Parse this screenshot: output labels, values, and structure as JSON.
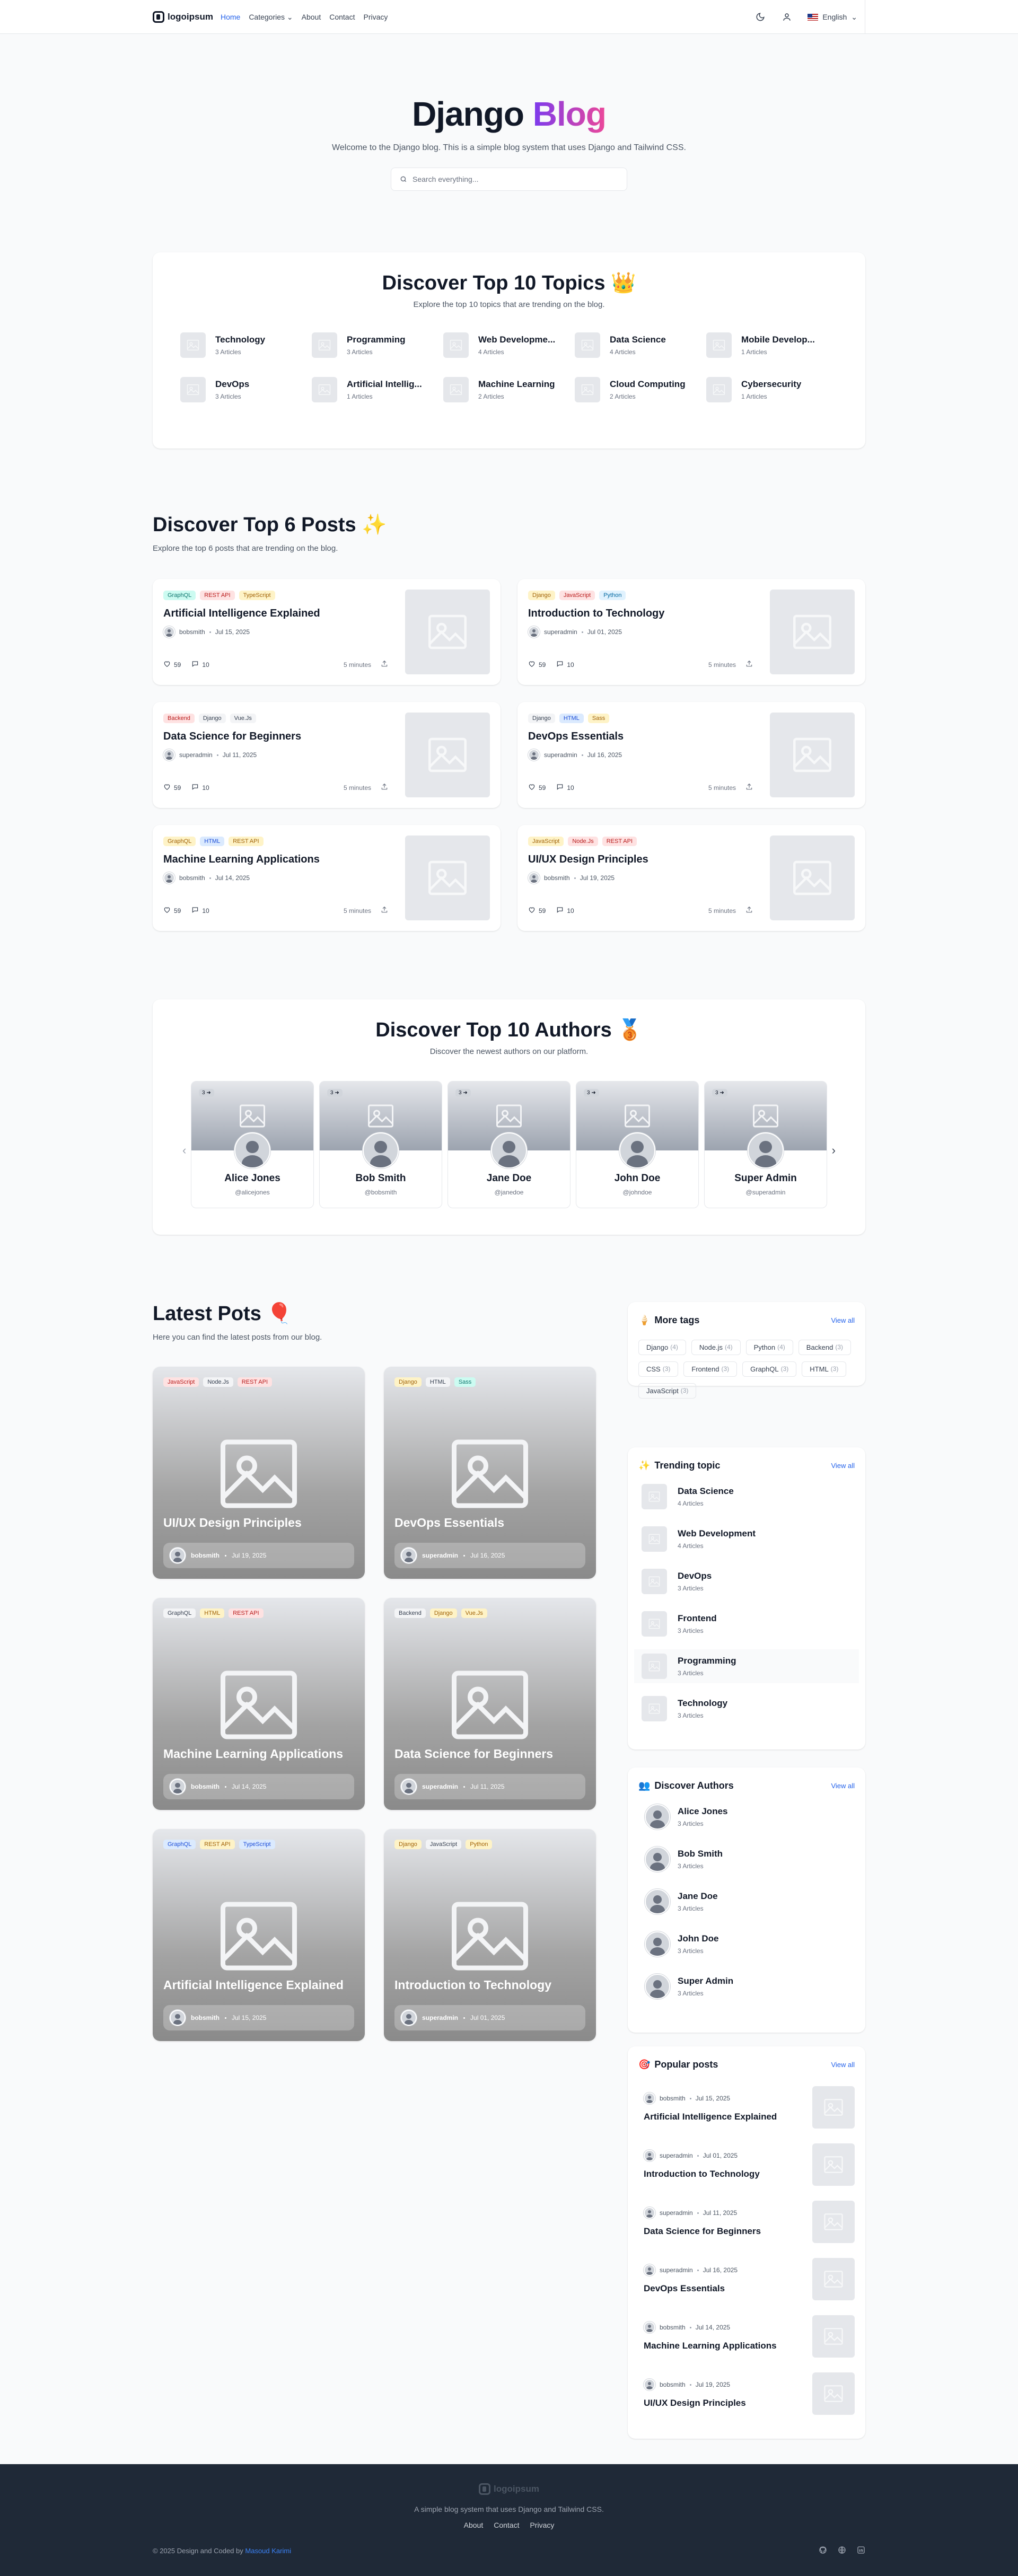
{
  "nav": {
    "brand": "logoipsum",
    "links": [
      "Home",
      "Categories",
      "About",
      "Contact",
      "Privacy"
    ],
    "lang": "English"
  },
  "hero": {
    "title_a": "Django",
    "title_b": "Blog",
    "subtitle": "Welcome to the Django blog. This is a simple blog system that uses Django and Tailwind CSS.",
    "search_placeholder": "Search everything..."
  },
  "topics": {
    "title": "Discover Top 10 Topics",
    "emoji": "👑",
    "subtitle": "Explore the top 10 topics that are trending on the blog.",
    "items": [
      {
        "name": "Technology",
        "count": "3 Articles"
      },
      {
        "name": "Programming",
        "count": "3 Articles"
      },
      {
        "name": "Web Developme...",
        "count": "4 Articles"
      },
      {
        "name": "Data Science",
        "count": "4 Articles"
      },
      {
        "name": "Mobile Develop...",
        "count": "1 Articles"
      },
      {
        "name": "DevOps",
        "count": "3 Articles"
      },
      {
        "name": "Artificial Intellig...",
        "count": "1 Articles"
      },
      {
        "name": "Machine Learning",
        "count": "2 Articles"
      },
      {
        "name": "Cloud Computing",
        "count": "2 Articles"
      },
      {
        "name": "Cybersecurity",
        "count": "1 Articles"
      }
    ]
  },
  "top_posts": {
    "title": "Discover Top 6 Posts",
    "emoji": "✨",
    "subtitle": "Explore the top 6 posts that are trending on the blog.",
    "items": [
      {
        "tags": [
          [
            "GraphQL",
            "teal"
          ],
          [
            "REST API",
            "red"
          ],
          [
            "TypeScript",
            "yellow"
          ]
        ],
        "title": "Artificial Intelligence Explained",
        "author": "bobsmith",
        "date": "Jul 15, 2025",
        "likes": "59",
        "comments": "10",
        "read": "5 minutes"
      },
      {
        "tags": [
          [
            "Django",
            "yellow"
          ],
          [
            "JavaScript",
            "red"
          ],
          [
            "Python",
            "sky"
          ]
        ],
        "title": "Introduction to Technology",
        "author": "superadmin",
        "date": "Jul 01, 2025",
        "likes": "59",
        "comments": "10",
        "read": "5 minutes"
      },
      {
        "tags": [
          [
            "Backend",
            "red"
          ],
          [
            "Django",
            "gray"
          ],
          [
            "Vue.Js",
            "gray"
          ]
        ],
        "title": "Data Science for Beginners",
        "author": "superadmin",
        "date": "Jul 11, 2025",
        "likes": "59",
        "comments": "10",
        "read": "5 minutes"
      },
      {
        "tags": [
          [
            "Django",
            "gray"
          ],
          [
            "HTML",
            "blue"
          ],
          [
            "Sass",
            "yellow"
          ]
        ],
        "title": "DevOps Essentials",
        "author": "superadmin",
        "date": "Jul 16, 2025",
        "likes": "59",
        "comments": "10",
        "read": "5 minutes"
      },
      {
        "tags": [
          [
            "GraphQL",
            "yellow"
          ],
          [
            "HTML",
            "blue"
          ],
          [
            "REST API",
            "yellow"
          ]
        ],
        "title": "Machine Learning Applications",
        "author": "bobsmith",
        "date": "Jul 14, 2025",
        "likes": "59",
        "comments": "10",
        "read": "5 minutes"
      },
      {
        "tags": [
          [
            "JavaScript",
            "yellow"
          ],
          [
            "Node.Js",
            "red"
          ],
          [
            "REST API",
            "red"
          ]
        ],
        "title": "UI/UX Design Principles",
        "author": "bobsmith",
        "date": "Jul 19, 2025",
        "likes": "59",
        "comments": "10",
        "read": "5 minutes"
      }
    ]
  },
  "authors": {
    "title": "Discover Top 10 Authors",
    "emoji": "🥉",
    "subtitle": "Discover the newest authors on our platform.",
    "badge": "3 ➜",
    "items": [
      {
        "name": "Alice Jones",
        "user": "@alicejones"
      },
      {
        "name": "Bob Smith",
        "user": "@bobsmith"
      },
      {
        "name": "Jane Doe",
        "user": "@janedoe"
      },
      {
        "name": "John Doe",
        "user": "@johndoe"
      },
      {
        "name": "Super Admin",
        "user": "@superadmin"
      }
    ]
  },
  "latest": {
    "title": "Latest Pots",
    "emoji": "🎈",
    "subtitle": "Here you can find the latest posts from our blog.",
    "items": [
      {
        "tags": [
          [
            "JavaScript",
            "red"
          ],
          [
            "Node.Js",
            "gray"
          ],
          [
            "REST API",
            "red"
          ]
        ],
        "title": "UI/UX Design Principles",
        "author": "bobsmith",
        "date": "Jul 19, 2025"
      },
      {
        "tags": [
          [
            "Django",
            "yellow"
          ],
          [
            "HTML",
            "gray"
          ],
          [
            "Sass",
            "teal"
          ]
        ],
        "title": "DevOps Essentials",
        "author": "superadmin",
        "date": "Jul 16, 2025"
      },
      {
        "tags": [
          [
            "GraphQL",
            "gray"
          ],
          [
            "HTML",
            "yellow"
          ],
          [
            "REST API",
            "red"
          ]
        ],
        "title": "Machine Learning Applications",
        "author": "bobsmith",
        "date": "Jul 14, 2025"
      },
      {
        "tags": [
          [
            "Backend",
            "gray"
          ],
          [
            "Django",
            "yellow"
          ],
          [
            "Vue.Js",
            "yellow"
          ]
        ],
        "title": "Data Science for Beginners",
        "author": "superadmin",
        "date": "Jul 11, 2025"
      },
      {
        "tags": [
          [
            "GraphQL",
            "blue"
          ],
          [
            "REST API",
            "yellow"
          ],
          [
            "TypeScript",
            "blue"
          ]
        ],
        "title": "Artificial Intelligence Explained",
        "author": "bobsmith",
        "date": "Jul 15, 2025"
      },
      {
        "tags": [
          [
            "Django",
            "yellow"
          ],
          [
            "JavaScript",
            "gray"
          ],
          [
            "Python",
            "yellow"
          ]
        ],
        "title": "Introduction to Technology",
        "author": "superadmin",
        "date": "Jul 01, 2025"
      }
    ]
  },
  "sidebar": {
    "view_all": "View all",
    "tags": {
      "title": "More tags",
      "emoji": "🍦",
      "items": [
        [
          "Django",
          "(4)"
        ],
        [
          "Node.js",
          "(4)"
        ],
        [
          "Python",
          "(4)"
        ],
        [
          "Backend",
          "(3)"
        ],
        [
          "CSS",
          "(3)"
        ],
        [
          "Frontend",
          "(3)"
        ],
        [
          "GraphQL",
          "(3)"
        ],
        [
          "HTML",
          "(3)"
        ],
        [
          "JavaScript",
          "(3)"
        ]
      ]
    },
    "trending": {
      "title": "Trending topic",
      "emoji": "✨",
      "items": [
        [
          "Data Science",
          "4 Articles"
        ],
        [
          "Web Development",
          "4 Articles"
        ],
        [
          "DevOps",
          "3 Articles"
        ],
        [
          "Frontend",
          "3 Articles"
        ],
        [
          "Programming",
          "3 Articles"
        ],
        [
          "Technology",
          "3 Articles"
        ]
      ]
    },
    "authors": {
      "title": "Discover Authors",
      "emoji": "👥",
      "items": [
        [
          "Alice Jones",
          "3 Articles"
        ],
        [
          "Bob Smith",
          "3 Articles"
        ],
        [
          "Jane Doe",
          "3 Articles"
        ],
        [
          "John Doe",
          "3 Articles"
        ],
        [
          "Super Admin",
          "3 Articles"
        ]
      ]
    },
    "popular": {
      "title": "Popular posts",
      "emoji": "🎯",
      "items": [
        {
          "author": "bobsmith",
          "date": "Jul 15, 2025",
          "title": "Artificial Intelligence Explained"
        },
        {
          "author": "superadmin",
          "date": "Jul 01, 2025",
          "title": "Introduction to Technology"
        },
        {
          "author": "superadmin",
          "date": "Jul 11, 2025",
          "title": "Data Science for Beginners"
        },
        {
          "author": "superadmin",
          "date": "Jul 16, 2025",
          "title": "DevOps Essentials"
        },
        {
          "author": "bobsmith",
          "date": "Jul 14, 2025",
          "title": "Machine Learning Applications"
        },
        {
          "author": "bobsmith",
          "date": "Jul 19, 2025",
          "title": "UI/UX Design Principles"
        }
      ]
    }
  },
  "footer": {
    "brand": "logoipsum",
    "desc": "A simple blog system that uses Django and Tailwind CSS.",
    "links": [
      "About",
      "Contact",
      "Privacy"
    ],
    "copy": "© 2025 Design and Coded by",
    "author": "Masoud Karimi"
  }
}
